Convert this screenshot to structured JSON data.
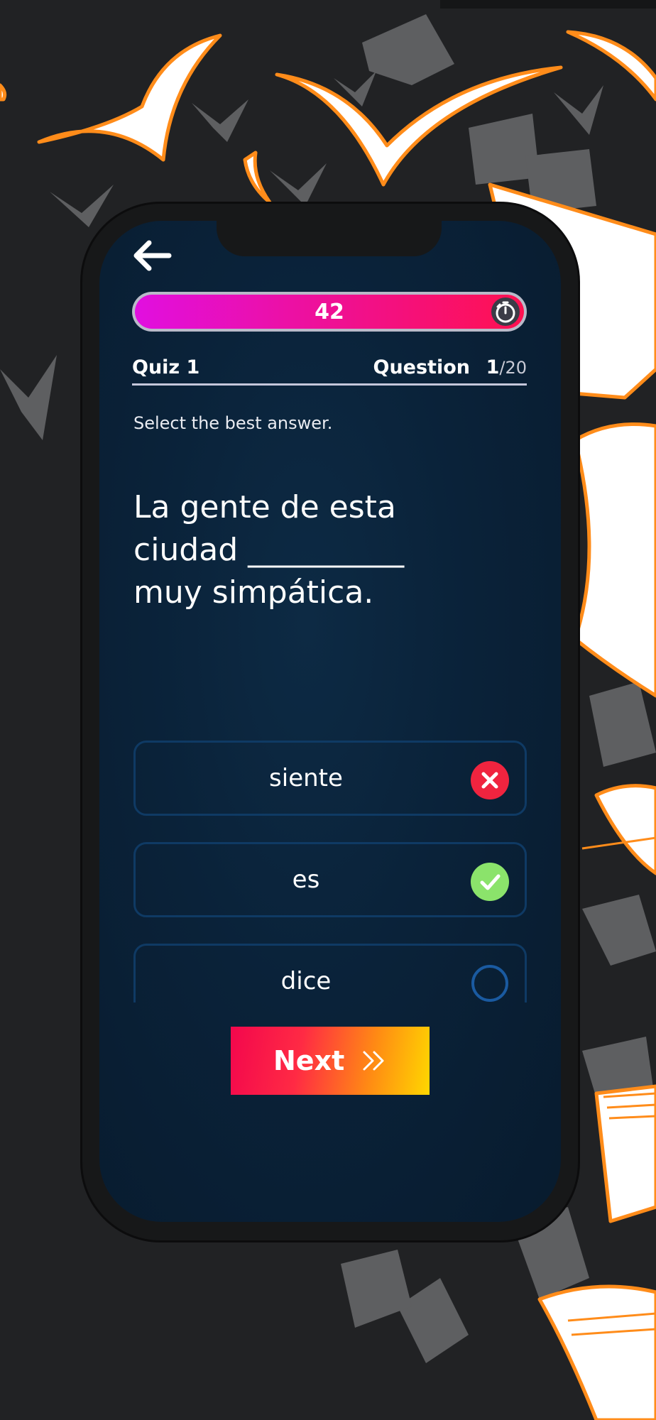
{
  "colors": {
    "background": "#212224",
    "screen": "#0a2239",
    "accent_magenta": "#e10fe0",
    "accent_red": "#ff1150",
    "wrong": "#f0243f",
    "correct": "#8be36b",
    "option_border": "#0f3a64",
    "book_outline": "#ff8c1a"
  },
  "timer": {
    "value": "42",
    "icon": "stopwatch-icon"
  },
  "header": {
    "back_icon": "arrow-left-icon",
    "quiz_label": "Quiz 1",
    "question_label": "Question",
    "question_number": "1",
    "question_total": "/20"
  },
  "instruction": "Select the best answer.",
  "question": {
    "line1": "La gente de esta",
    "line2": "ciudad __________",
    "line3": "muy simpática."
  },
  "options": [
    {
      "label": "siente",
      "status": "wrong",
      "icon": "x-circle-icon"
    },
    {
      "label": "es",
      "status": "correct",
      "icon": "check-circle-icon"
    },
    {
      "label": "dice",
      "status": "unanswered",
      "icon": "empty-circle-icon"
    }
  ],
  "next_button": {
    "label": "Next",
    "icon": "double-chevron-right-icon"
  }
}
